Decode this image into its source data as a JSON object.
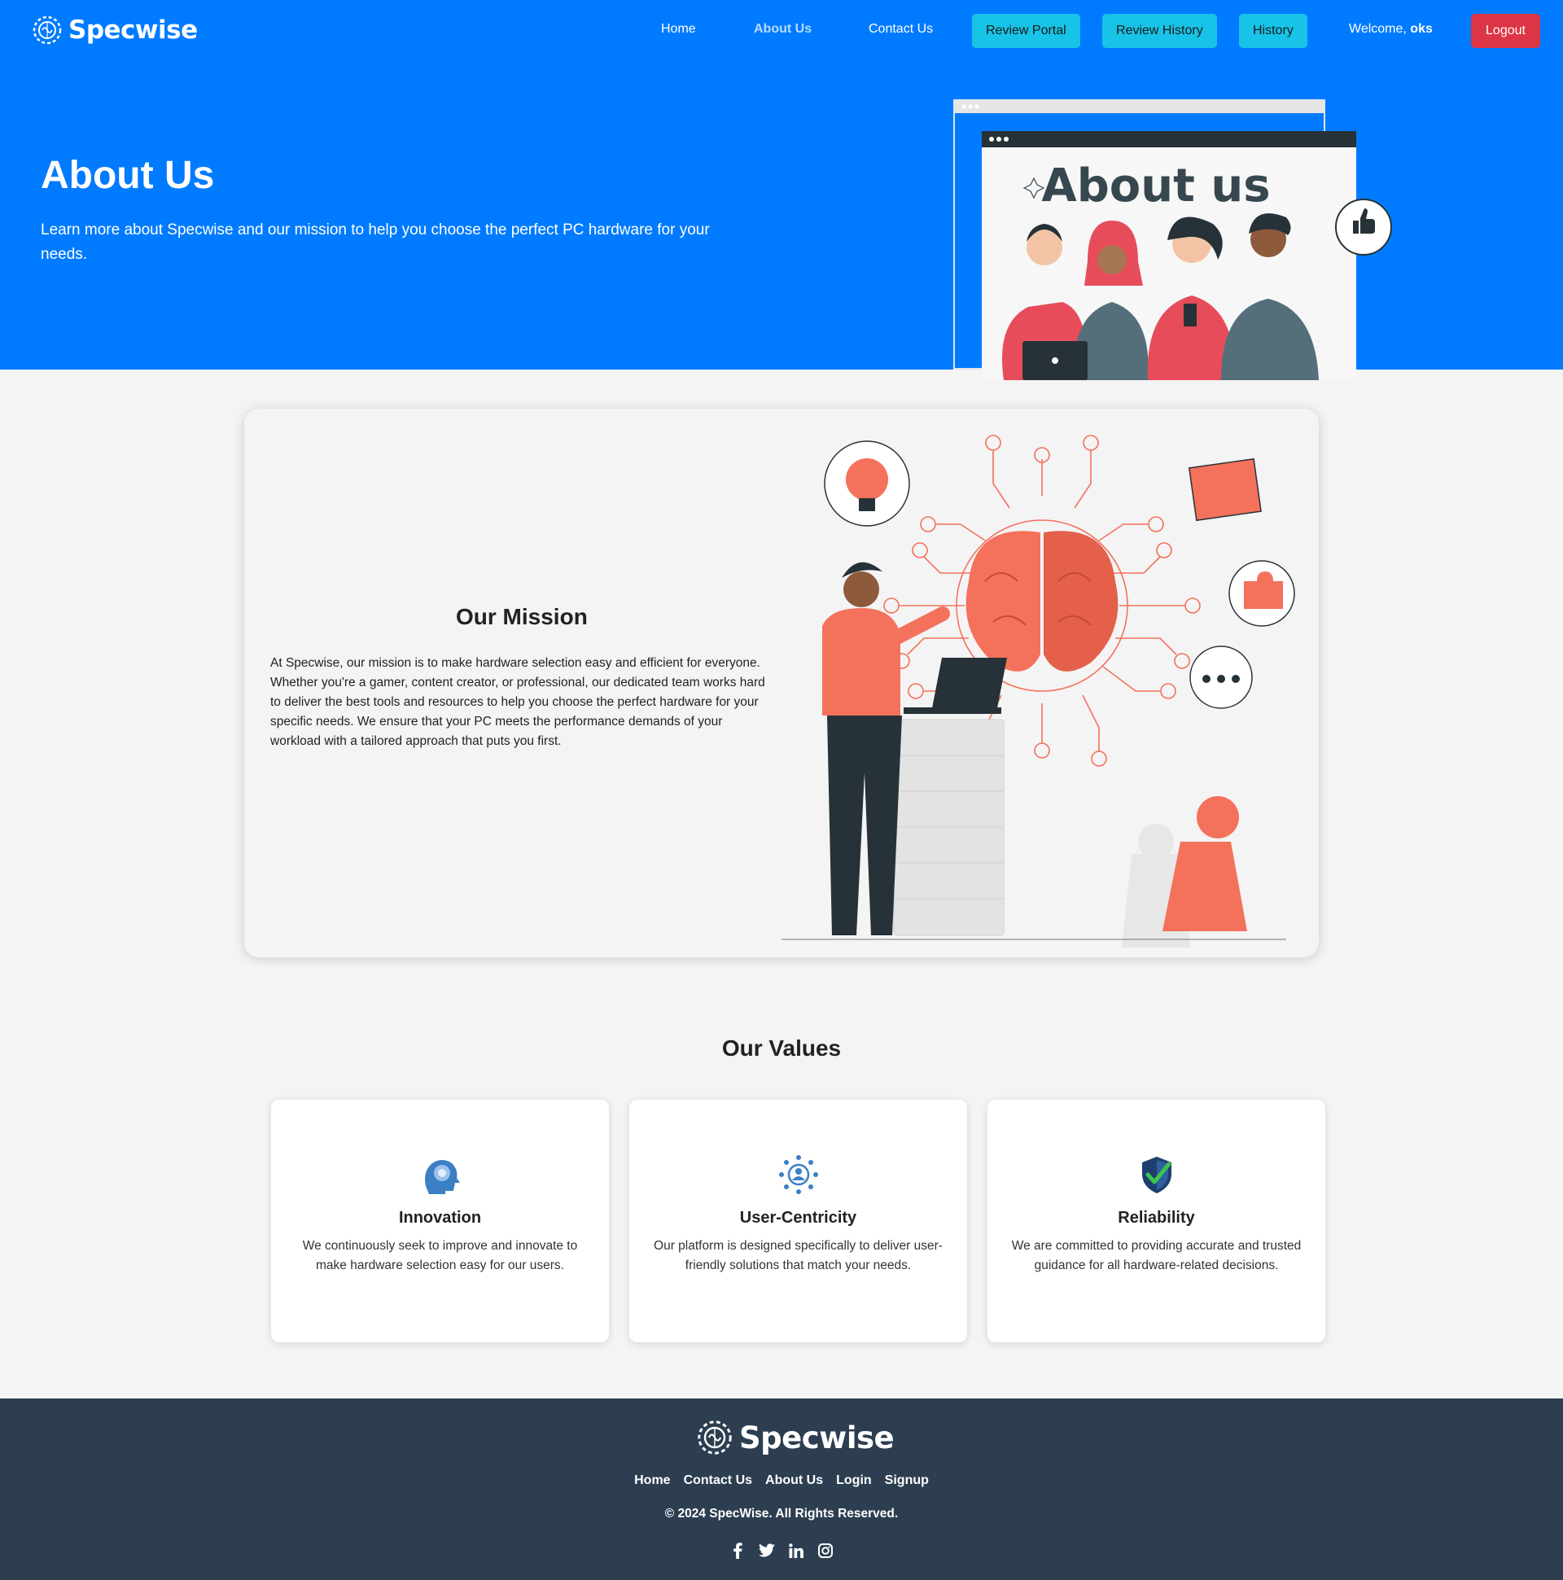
{
  "brand": {
    "name": "Specwise"
  },
  "nav": {
    "links": [
      "Home",
      "About Us",
      "Contact Us"
    ],
    "buttons": [
      "Review Portal",
      "Review History",
      "History"
    ],
    "welcome_prefix": "Welcome,",
    "username": "oks",
    "logout": "Logout"
  },
  "hero": {
    "title": "About Us",
    "subtitle": "Learn more about Specwise and our mission to help you choose the perfect PC hardware for your needs.",
    "illustration_text": "About us"
  },
  "mission": {
    "title": "Our Mission",
    "text": "At Specwise, our mission is to make hardware selection easy and efficient for everyone. Whether you're a gamer, content creator, or professional, our dedicated team works hard to deliver the best tools and resources to help you choose the perfect hardware for your specific needs. We ensure that your PC meets the performance demands of your workload with a tailored approach that puts you first."
  },
  "values": {
    "title": "Our Values",
    "items": [
      {
        "title": "Innovation",
        "text": "We continuously seek to improve and innovate to make hardware selection easy for our users.",
        "icon": "brain-head-icon"
      },
      {
        "title": "User-Centricity",
        "text": "Our platform is designed specifically to deliver user-friendly solutions that match your needs.",
        "icon": "user-network-icon"
      },
      {
        "title": "Reliability",
        "text": "We are committed to providing accurate and trusted guidance for all hardware-related decisions.",
        "icon": "shield-check-icon"
      }
    ]
  },
  "footer": {
    "brand": "Specwise",
    "links": [
      "Home",
      "Contact Us",
      "About Us",
      "Login",
      "Signup"
    ],
    "copyright": "© 2024 SpecWise. All Rights Reserved.",
    "social": [
      "facebook-icon",
      "twitter-icon",
      "linkedin-icon",
      "instagram-icon"
    ]
  },
  "colors": {
    "primary": "#007bff",
    "info_button": "#17c3e6",
    "danger": "#dc3545",
    "footer_bg": "#2c3e50",
    "illustration_accent": "#f4715b"
  }
}
